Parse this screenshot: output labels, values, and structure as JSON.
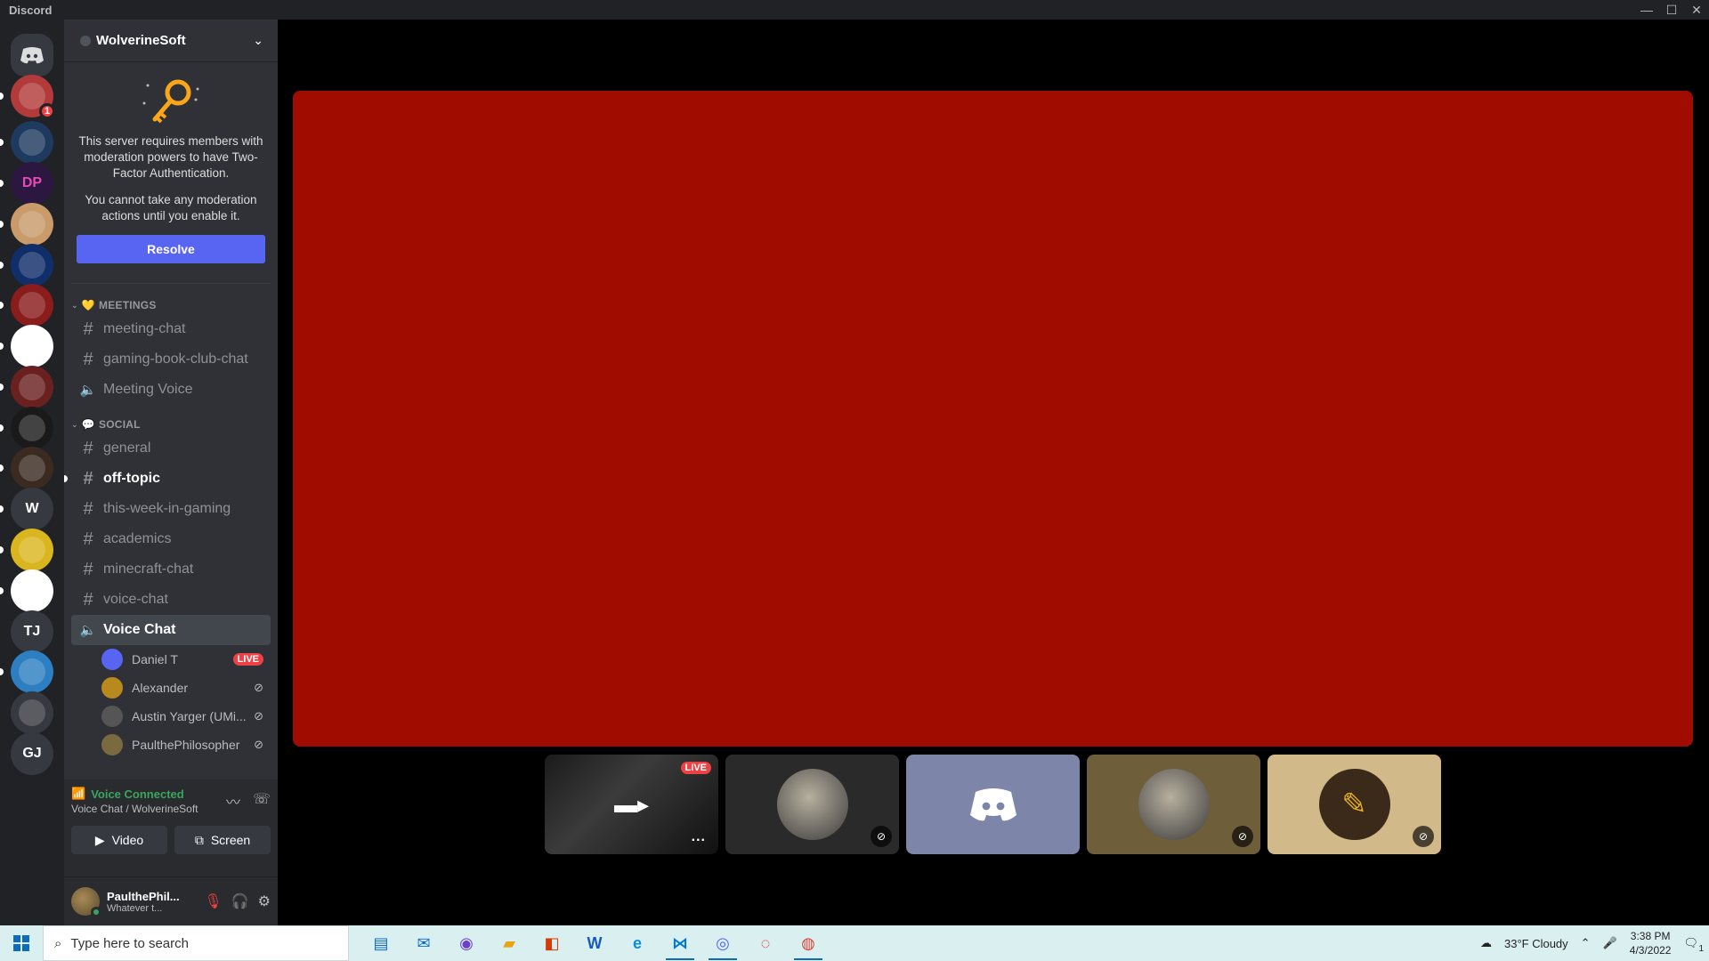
{
  "window": {
    "title": "Discord",
    "controls": [
      "—",
      "☐",
      "✕"
    ]
  },
  "servers": [
    {
      "name": "home",
      "initials": "",
      "color": "#36393f",
      "icon": "discord-logo-icon",
      "badge": ""
    },
    {
      "name": "server-1",
      "initials": "",
      "color": "#b33a3a",
      "icon": "avatar-icon",
      "badge": "1"
    },
    {
      "name": "server-2",
      "initials": "",
      "color": "#1e3a5f",
      "icon": "bird-icon",
      "badge": ""
    },
    {
      "name": "server-3",
      "initials": "DP",
      "color": "#2b1740",
      "icon": "",
      "badge": ""
    },
    {
      "name": "server-4",
      "initials": "",
      "color": "#c99a6a",
      "icon": "dog-icon",
      "badge": ""
    },
    {
      "name": "server-5",
      "initials": "",
      "color": "#0f2e6a",
      "icon": "yin-yang-icon",
      "badge": ""
    },
    {
      "name": "server-6",
      "initials": "",
      "color": "#8a1c1c",
      "icon": "box-icon",
      "badge": ""
    },
    {
      "name": "server-7",
      "initials": "",
      "color": "#ffffff",
      "icon": "pattern-icon",
      "badge": ""
    },
    {
      "name": "server-8",
      "initials": "",
      "color": "#6b2020",
      "icon": "face-icon",
      "badge": ""
    },
    {
      "name": "server-9",
      "initials": "",
      "color": "#1a1a1a",
      "icon": "emblem-icon",
      "badge": ""
    },
    {
      "name": "server-10",
      "initials": "",
      "color": "#3a2a20",
      "icon": "robot-icon",
      "badge": ""
    },
    {
      "name": "server-11",
      "initials": "W",
      "color": "#36393f",
      "icon": "",
      "badge": ""
    },
    {
      "name": "server-12",
      "initials": "",
      "color": "#d9b61f",
      "icon": "symbol-icon",
      "badge": ""
    },
    {
      "name": "server-13",
      "initials": "",
      "color": "#ffffff",
      "icon": "f-logo-icon",
      "badge": ""
    },
    {
      "name": "server-14",
      "initials": "TJ",
      "color": "#36393f",
      "icon": "",
      "badge": ""
    },
    {
      "name": "server-15",
      "initials": "",
      "color": "#2d7fc1",
      "icon": "character-icon",
      "badge": ""
    },
    {
      "name": "server-16",
      "initials": "",
      "color": "#36393f",
      "icon": "controller-icon",
      "badge": ""
    },
    {
      "name": "server-17",
      "initials": "GJ",
      "color": "#36393f",
      "icon": "",
      "badge": ""
    }
  ],
  "sidebar": {
    "server_name": "WolverineSoft",
    "tfa": {
      "line1": "This server requires members with moderation powers to have Two-Factor Authentication.",
      "line2": "You cannot take any moderation actions until you enable it.",
      "button": "Resolve"
    },
    "categories": [
      {
        "name": "MEETINGS",
        "emoji": "💛",
        "channels": [
          {
            "type": "text",
            "name": "meeting-chat"
          },
          {
            "type": "text",
            "name": "gaming-book-club-chat"
          },
          {
            "type": "voice",
            "name": "Meeting Voice"
          }
        ]
      },
      {
        "name": "SOCIAL",
        "emoji": "💬",
        "channels": [
          {
            "type": "text",
            "name": "general"
          },
          {
            "type": "text",
            "name": "off-topic",
            "unread": true
          },
          {
            "type": "text",
            "name": "this-week-in-gaming"
          },
          {
            "type": "text",
            "name": "academics"
          },
          {
            "type": "text",
            "name": "minecraft-chat"
          },
          {
            "type": "text",
            "name": "voice-chat"
          },
          {
            "type": "voice",
            "name": "Voice Chat",
            "active": true
          }
        ]
      }
    ],
    "voice_users": [
      {
        "name": "Daniel T",
        "live": "LIVE",
        "muted": false
      },
      {
        "name": "Alexander",
        "live": "",
        "muted": true
      },
      {
        "name": "Austin Yarger (UMi...",
        "live": "",
        "muted": true
      },
      {
        "name": "PaulthePhilosopher",
        "live": "",
        "muted": true
      }
    ],
    "voice_panel": {
      "status": "Voice Connected",
      "location": "Voice Chat / WolverineSoft",
      "video_label": "Video",
      "screen_label": "Screen"
    },
    "user_panel": {
      "name": "PaulthePhil...",
      "custom_status": "Whatever t..."
    }
  },
  "stage": {
    "stream_color": "#a00c00",
    "tiles": [
      {
        "kind": "stream",
        "live": "LIVE",
        "more": "..."
      },
      {
        "kind": "user",
        "bg": "#2a2a2a",
        "muted": true
      },
      {
        "kind": "discord",
        "bg": "#7d86a8",
        "muted": false
      },
      {
        "kind": "user",
        "bg": "#6e5e3a",
        "muted": true
      },
      {
        "kind": "pencil",
        "bg": "#d1b98a",
        "muted": true
      }
    ]
  },
  "taskbar": {
    "search_placeholder": "Type here to search",
    "weather": "33°F  Cloudy",
    "time": "3:38 PM",
    "date": "4/3/2022",
    "notification_count": "1"
  }
}
